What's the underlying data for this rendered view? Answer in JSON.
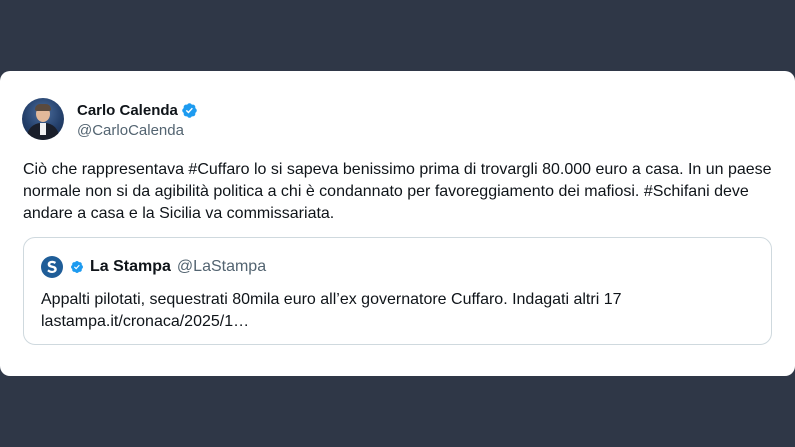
{
  "colors": {
    "background": "#2f3747",
    "card": "#ffffff",
    "verified": "#1d9bf0",
    "text": "#0f1419",
    "muted": "#536471",
    "border": "#cfd9de"
  },
  "tweet": {
    "author": {
      "display_name": "Carlo Calenda",
      "handle": "@CarloCalenda",
      "avatar_icon": "user-avatar",
      "verified_icon": "verified-badge-icon"
    },
    "text": "Ciò che rappresentava #Cuffaro lo si sapeva benissimo prima di trovargli 80.000 euro a casa. In un paese normale non si da agibilità politica a chi è condannato per favoreggiamento dei mafiosi. #Schifani deve andare a casa e la Sicilia va commissariata.",
    "quote": {
      "logo_icon": "la-stampa-logo-icon",
      "verified_icon": "verified-badge-icon",
      "display_name": "La Stampa",
      "handle": "@LaStampa",
      "text_line1": "Appalti pilotati, sequestrati 80mila euro all’ex governatore Cuffaro. Indagati altri 17",
      "text_line2": "lastampa.it/cronaca/2025/1…"
    }
  }
}
